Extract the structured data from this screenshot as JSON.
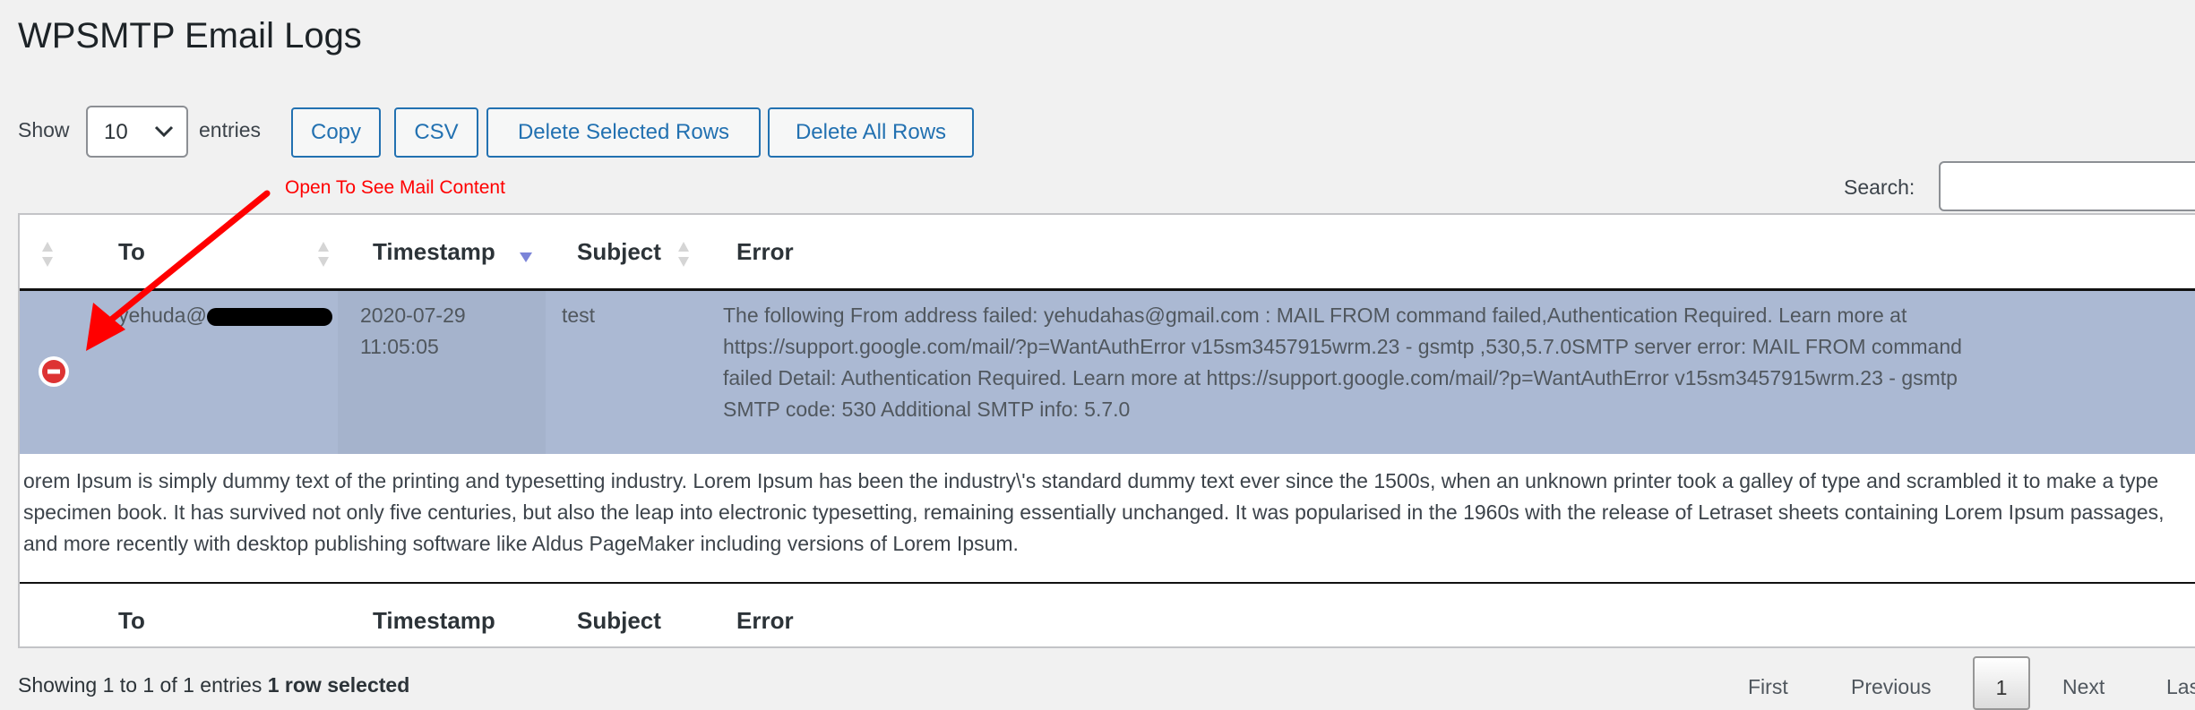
{
  "page_title": "WPSMTP Email Logs",
  "controls": {
    "show_label": "Show",
    "entries_value": "10",
    "entries_label": "entries",
    "buttons": [
      "Copy",
      "CSV",
      "Delete Selected Rows",
      "Delete All Rows"
    ],
    "search_label": "Search:",
    "search_value": ""
  },
  "annotation": {
    "text": "Open To See Mail Content",
    "color": "#ff0000"
  },
  "table": {
    "columns": [
      "To",
      "Timestamp",
      "Subject",
      "Error"
    ],
    "sorted_column": "Timestamp",
    "sort_direction": "descending",
    "rows": [
      {
        "to": "yehuda@",
        "timestamp_date": "2020-07-29",
        "timestamp_time": "11:05:05",
        "subject": "test",
        "error_lines": [
          "The following From address failed: yehudahas@gmail.com : MAIL FROM command failed,Authentication Required. Learn more at",
          "https://support.google.com/mail/?p=WantAuthError v15sm3457915wrm.23 - gsmtp ,530,5.7.0SMTP server error: MAIL FROM command",
          "failed Detail: Authentication Required. Learn more at https://support.google.com/mail/?p=WantAuthError v15sm3457915wrm.23 - gsmtp",
          "SMTP code: 530 Additional SMTP info: 5.7.0"
        ],
        "selected": true,
        "expanded": true,
        "mail_content": "orem Ipsum is simply dummy text of the printing and typesetting industry. Lorem Ipsum has been the industry\\'s standard dummy text ever since the 1500s, when an unknown printer took a galley of type and scrambled it to make a type specimen book. It has survived not only five centuries, but also the leap into electronic typesetting, remaining essentially unchanged. It was popularised in the 1960s with the release of Letraset sheets containing Lorem Ipsum passages, and more recently with desktop publishing software like Aldus PageMaker including versions of Lorem Ipsum."
      }
    ],
    "selected_row_color": "#abb9d3"
  },
  "footer": {
    "info": "Showing 1 to 1 of 1 entries",
    "selected_info": "1 row selected",
    "pagination": [
      "First",
      "Previous",
      "1",
      "Next",
      "Las"
    ]
  }
}
